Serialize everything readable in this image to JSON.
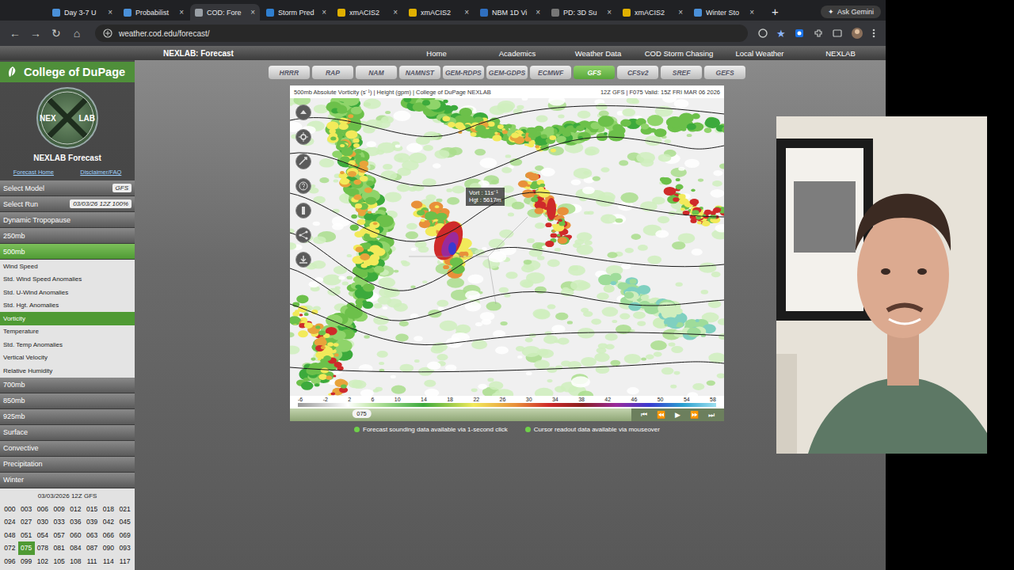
{
  "browser": {
    "tabs": [
      {
        "label": "Day 3-7 U",
        "selected": false,
        "icon_color": "#4a90d9"
      },
      {
        "label": "Probabilist",
        "selected": false,
        "icon_color": "#4a90d9"
      },
      {
        "label": "COD: Fore",
        "selected": true,
        "icon_color": "#9aa0a6"
      },
      {
        "label": "Storm Pred",
        "selected": false,
        "icon_color": "#2f7fd0"
      },
      {
        "label": "xmACIS2",
        "selected": false,
        "icon_color": "#e0b000"
      },
      {
        "label": "xmACIS2",
        "selected": false,
        "icon_color": "#e0b000"
      },
      {
        "label": "NBM 1D Vi",
        "selected": false,
        "icon_color": "#2f6fc0"
      },
      {
        "label": "PD: 3D Su",
        "selected": false,
        "icon_color": "#777777"
      },
      {
        "label": "xmACIS2",
        "selected": false,
        "icon_color": "#e0b000"
      },
      {
        "label": "Winter Sto",
        "selected": false,
        "icon_color": "#4a90d9"
      }
    ],
    "close_glyph": "×",
    "new_tab": "+",
    "gemini_icon": "✦",
    "gemini_label": "Ask Gemini",
    "nav_icons": [
      "←",
      "→",
      "↻",
      "⌂"
    ],
    "url": "weather.cod.edu/forecast/",
    "bookmark_icon": "★"
  },
  "site": {
    "header_title": "NEXLAB: Forecast",
    "nav": [
      "Home",
      "Academics",
      "Weather Data",
      "COD Storm Chasing",
      "Local Weather",
      "NEXLAB"
    ]
  },
  "sidebar": {
    "logo_text": "College of DuPage",
    "emblem": [
      "NEX",
      "LAB"
    ],
    "title": "NEXLAB Forecast",
    "links": [
      "Forecast Home",
      "Disclaimer/FAQ"
    ],
    "select_model": {
      "label": "Select Model",
      "value": "GFS"
    },
    "select_run": {
      "label": "Select Run",
      "value": "03/03/26 12Z 100%"
    },
    "menu": [
      {
        "label": "Dynamic Tropopause",
        "kind": "section",
        "selected": false
      },
      {
        "label": "250mb",
        "kind": "section",
        "selected": false
      },
      {
        "label": "500mb",
        "kind": "section",
        "selected": true
      },
      {
        "label": "Wind Speed",
        "kind": "item",
        "selected": false
      },
      {
        "label": "Std. Wind Speed Anomalies",
        "kind": "item",
        "selected": false
      },
      {
        "label": "Std. U-Wind Anomalies",
        "kind": "item",
        "selected": false
      },
      {
        "label": "Std. Hgt. Anomalies",
        "kind": "item",
        "selected": false
      },
      {
        "label": "Vorticity",
        "kind": "item",
        "selected": true
      },
      {
        "label": "Temperature",
        "kind": "item",
        "selected": false
      },
      {
        "label": "Std. Temp Anomalies",
        "kind": "item",
        "selected": false
      },
      {
        "label": "Vertical Velocity",
        "kind": "item",
        "selected": false
      },
      {
        "label": "Relative Humidity",
        "kind": "item",
        "selected": false
      },
      {
        "label": "700mb",
        "kind": "section",
        "selected": false
      },
      {
        "label": "850mb",
        "kind": "section",
        "selected": false
      },
      {
        "label": "925mb",
        "kind": "section",
        "selected": false
      },
      {
        "label": "Surface",
        "kind": "section",
        "selected": false
      },
      {
        "label": "Convective",
        "kind": "section",
        "selected": false
      },
      {
        "label": "Precipitation",
        "kind": "section",
        "selected": false
      },
      {
        "label": "Winter",
        "kind": "section",
        "selected": false
      }
    ],
    "run_title": "03/03/2026 12Z GFS",
    "hours": [
      {
        "label": "000",
        "selected": false
      },
      {
        "label": "003",
        "selected": false
      },
      {
        "label": "006",
        "selected": false
      },
      {
        "label": "009",
        "selected": false
      },
      {
        "label": "012",
        "selected": false
      },
      {
        "label": "015",
        "selected": false
      },
      {
        "label": "018",
        "selected": false
      },
      {
        "label": "021",
        "selected": false
      },
      {
        "label": "024",
        "selected": false
      },
      {
        "label": "027",
        "selected": false
      },
      {
        "label": "030",
        "selected": false
      },
      {
        "label": "033",
        "selected": false
      },
      {
        "label": "036",
        "selected": false
      },
      {
        "label": "039",
        "selected": false
      },
      {
        "label": "042",
        "selected": false
      },
      {
        "label": "045",
        "selected": false
      },
      {
        "label": "048",
        "selected": false
      },
      {
        "label": "051",
        "selected": false
      },
      {
        "label": "054",
        "selected": false
      },
      {
        "label": "057",
        "selected": false
      },
      {
        "label": "060",
        "selected": false
      },
      {
        "label": "063",
        "selected": false
      },
      {
        "label": "066",
        "selected": false
      },
      {
        "label": "069",
        "selected": false
      },
      {
        "label": "072",
        "selected": false
      },
      {
        "label": "075",
        "selected": true
      },
      {
        "label": "078",
        "selected": false
      },
      {
        "label": "081",
        "selected": false
      },
      {
        "label": "084",
        "selected": false
      },
      {
        "label": "087",
        "selected": false
      },
      {
        "label": "090",
        "selected": false
      },
      {
        "label": "093",
        "selected": false
      },
      {
        "label": "096",
        "selected": false
      },
      {
        "label": "099",
        "selected": false
      },
      {
        "label": "102",
        "selected": false
      },
      {
        "label": "105",
        "selected": false
      },
      {
        "label": "108",
        "selected": false
      },
      {
        "label": "111",
        "selected": false
      },
      {
        "label": "114",
        "selected": false
      },
      {
        "label": "117",
        "selected": false
      }
    ]
  },
  "models": [
    {
      "label": "HRRR",
      "selected": false
    },
    {
      "label": "RAP",
      "selected": false
    },
    {
      "label": "NAM",
      "selected": false
    },
    {
      "label": "NAMNST",
      "selected": false
    },
    {
      "label": "GEM-RDPS",
      "selected": false
    },
    {
      "label": "GEM-GDPS",
      "selected": false
    },
    {
      "label": "ECMWF",
      "selected": false
    },
    {
      "label": "GFS",
      "selected": true
    },
    {
      "label": "CFSv2",
      "selected": false
    },
    {
      "label": "SREF",
      "selected": false
    },
    {
      "label": "GEFS",
      "selected": false
    }
  ],
  "map": {
    "title": "500mb Absolute Vorticity (s⁻¹) | Height (gpm) | College of DuPage NEXLAB",
    "run": "12Z GFS | F075 Valid: 15Z FRI MAR 06 2026",
    "tooltip": [
      "Vort : 11s⁻¹",
      "Hgt : 5617m"
    ],
    "colorbar_ticks": [
      "-6",
      "-2",
      "2",
      "6",
      "10",
      "14",
      "18",
      "22",
      "26",
      "30",
      "34",
      "38",
      "42",
      "46",
      "50",
      "54",
      "58"
    ]
  },
  "player": {
    "hour": "075",
    "level": 0.21,
    "buttons": [
      "⏮",
      "⏪",
      "▶",
      "⏩",
      "⏭"
    ]
  },
  "notes": [
    "Forecast sounding data available via 1-second click",
    "Cursor readout data available via mouseover"
  ]
}
